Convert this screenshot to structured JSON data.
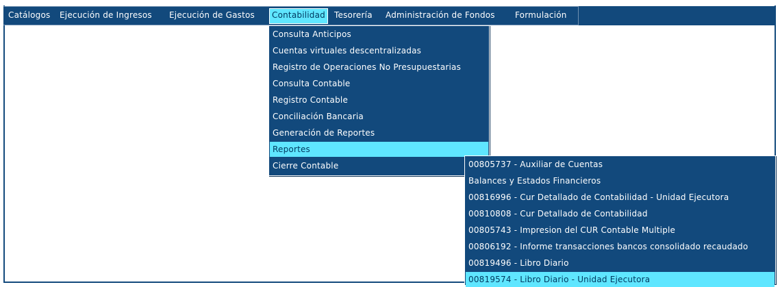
{
  "menubar": {
    "items": [
      {
        "label": "Catálogos"
      },
      {
        "label": "Ejecución de Ingresos"
      },
      {
        "label": "Ejecución de Gastos"
      },
      {
        "label": "Contabilidad"
      },
      {
        "label": "Tesorería"
      },
      {
        "label": "Administración de Fondos"
      },
      {
        "label": "Formulación"
      }
    ],
    "active": "Contabilidad"
  },
  "contabilidad_menu": {
    "items": [
      {
        "label": "Consulta Anticipos"
      },
      {
        "label": "Cuentas virtuales descentralizadas"
      },
      {
        "label": "Registro de Operaciones No Presupuestarias"
      },
      {
        "label": "Consulta Contable"
      },
      {
        "label": "Registro Contable"
      },
      {
        "label": "Conciliación Bancaria"
      },
      {
        "label": "Generación de Reportes"
      },
      {
        "label": "Reportes"
      },
      {
        "label": "Cierre Contable"
      }
    ],
    "active": "Reportes"
  },
  "reportes_submenu": {
    "items": [
      {
        "label": "00805737 - Auxiliar de Cuentas"
      },
      {
        "label": "Balances y Estados Financieros"
      },
      {
        "label": "00816996 - Cur Detallado de Contabilidad - Unidad Ejecutora"
      },
      {
        "label": "00810808 - Cur Detallado de Contabilidad"
      },
      {
        "label": "00805743 - Impresion del CUR Contable Multiple"
      },
      {
        "label": "00806192 - Informe transacciones bancos consolidado recaudado"
      },
      {
        "label": "00819496 - Libro Diario"
      },
      {
        "label": "00819574 - Libro Diario - Unidad Ejecutora"
      }
    ],
    "active": "00819574 - Libro Diario - Unidad Ejecutora"
  },
  "colors": {
    "menu_background": "#12497c",
    "highlight": "#5fe6ff",
    "text": "#ffffff"
  }
}
